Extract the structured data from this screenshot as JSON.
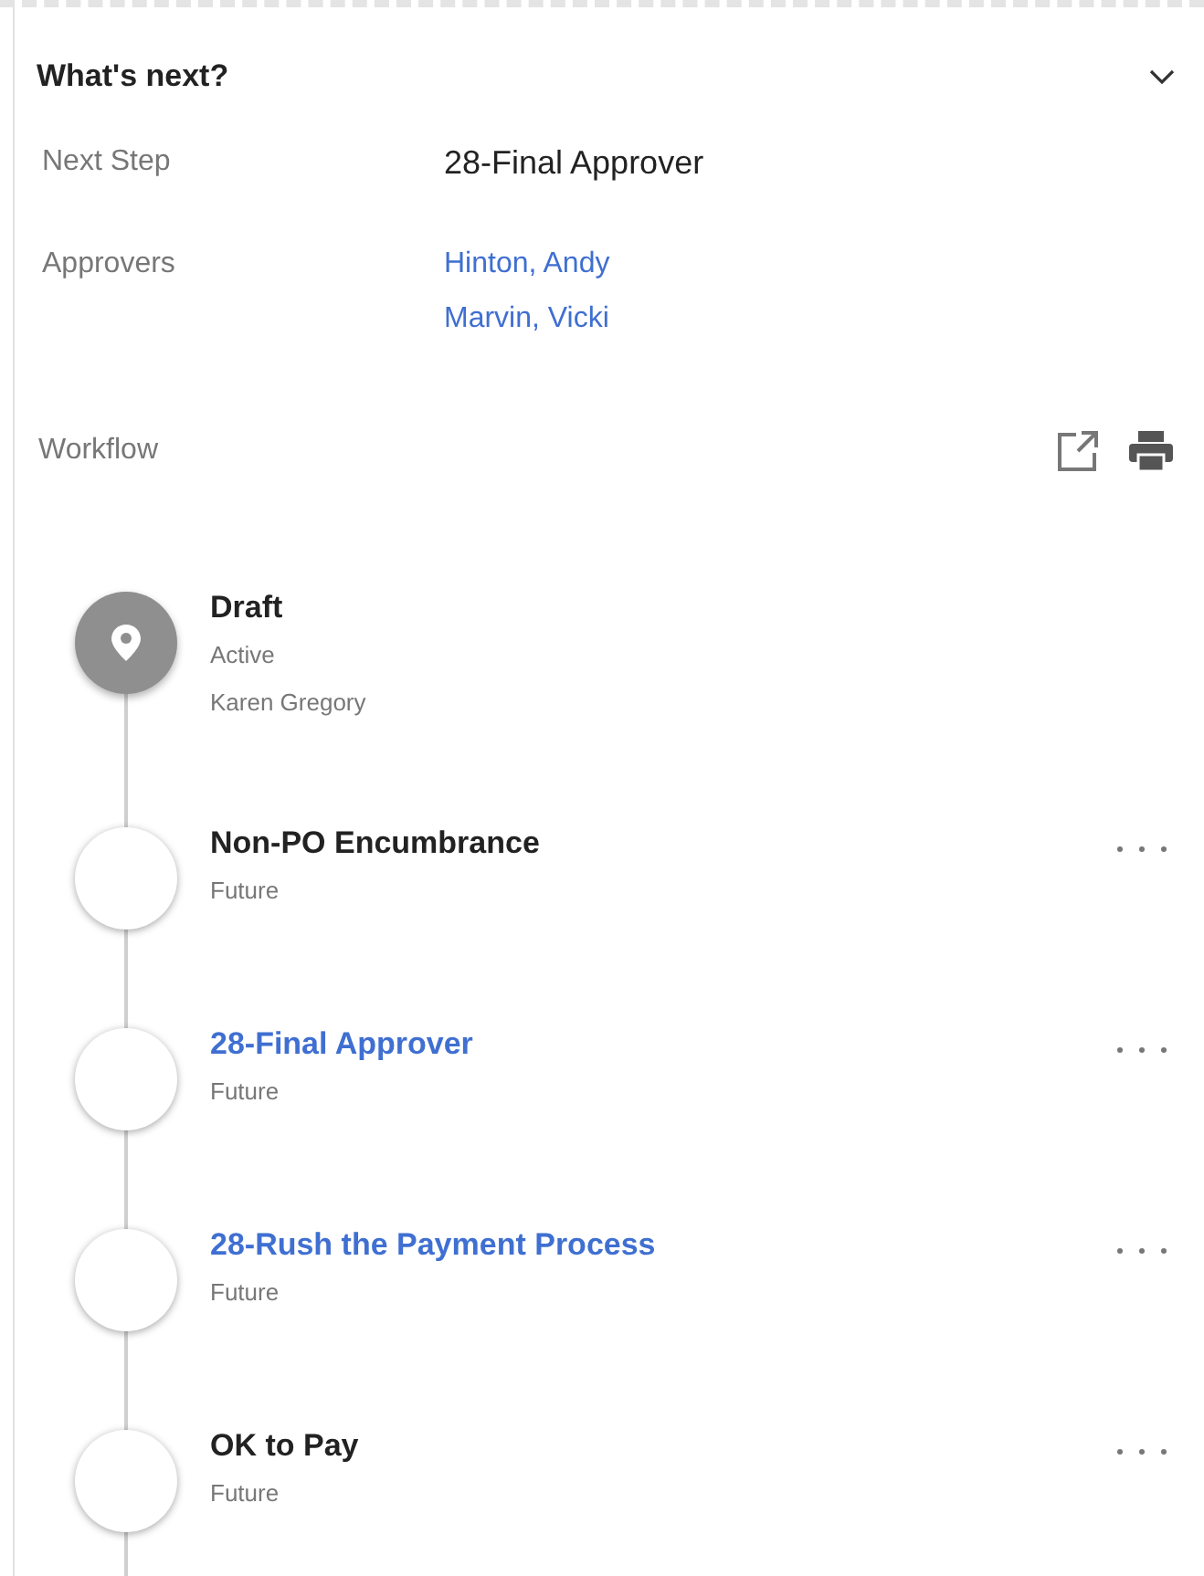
{
  "panel": {
    "title": "What's next?",
    "expanded": true
  },
  "fields": [
    {
      "label": "Next Step",
      "values": [
        {
          "text": "28-Final Approver",
          "link": false
        }
      ]
    },
    {
      "label": "Approvers",
      "values": [
        {
          "text": "Hinton, Andy",
          "link": true
        },
        {
          "text": "Marvin, Vicki",
          "link": true
        }
      ]
    }
  ],
  "workflow": {
    "label": "Workflow",
    "steps": [
      {
        "kind": "active",
        "title": "Draft",
        "link": false,
        "status": "Active",
        "person": "Karen Gregory",
        "menu": false
      },
      {
        "kind": "future",
        "title": "Non-PO Encumbrance",
        "link": false,
        "status": "Future",
        "menu": true
      },
      {
        "kind": "future",
        "title": "28-Final Approver",
        "link": true,
        "status": "Future",
        "menu": true
      },
      {
        "kind": "future",
        "title": "28-Rush the Payment Process",
        "link": true,
        "status": "Future",
        "menu": true
      },
      {
        "kind": "future",
        "title": "OK to Pay",
        "link": false,
        "status": "Future",
        "menu": true
      }
    ]
  }
}
